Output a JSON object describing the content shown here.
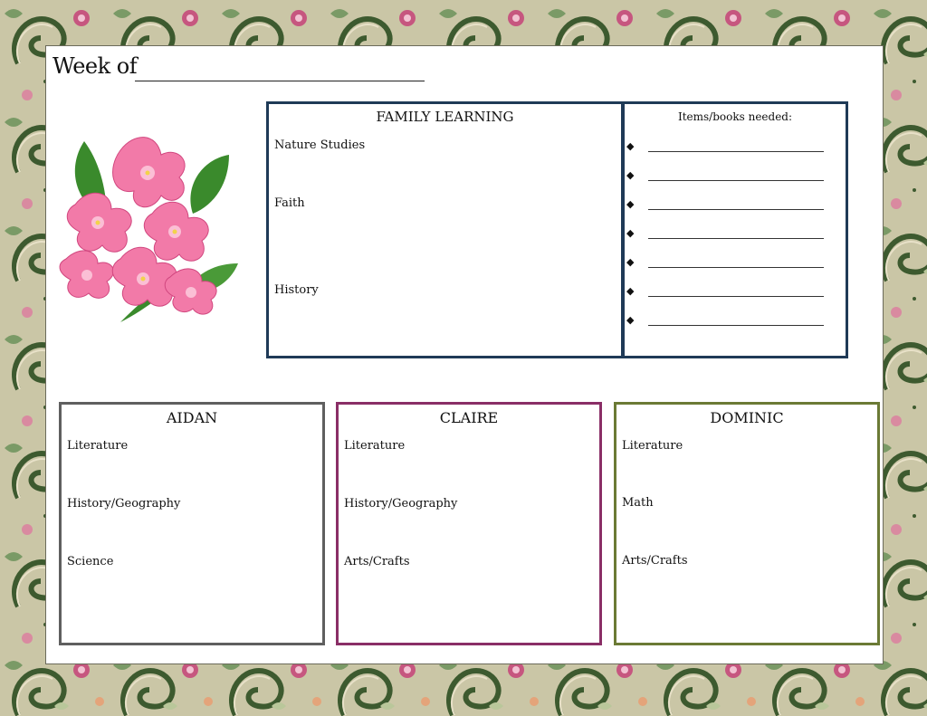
{
  "header": {
    "week_label": "Week of"
  },
  "family": {
    "title": "FAMILY LEARNING",
    "subjects": [
      "Nature Studies",
      "Faith",
      "History"
    ]
  },
  "items": {
    "title": "Items/books needed:",
    "bullet": "◆",
    "count": 7
  },
  "children": [
    {
      "name": "AIDAN",
      "subjects": [
        "Literature",
        "History/Geography",
        "Science"
      ],
      "color": "#5f5f5f"
    },
    {
      "name": "CLAIRE",
      "subjects": [
        "Literature",
        "History/Geography",
        "Arts/Crafts"
      ],
      "color": "#8a2e66"
    },
    {
      "name": "DOMINIC",
      "subjects": [
        "Literature",
        "Math",
        "Arts/Crafts"
      ],
      "color": "#6b7a35"
    }
  ],
  "colors": {
    "family_border": "#1f3a57",
    "background": "#c9c5a4"
  }
}
